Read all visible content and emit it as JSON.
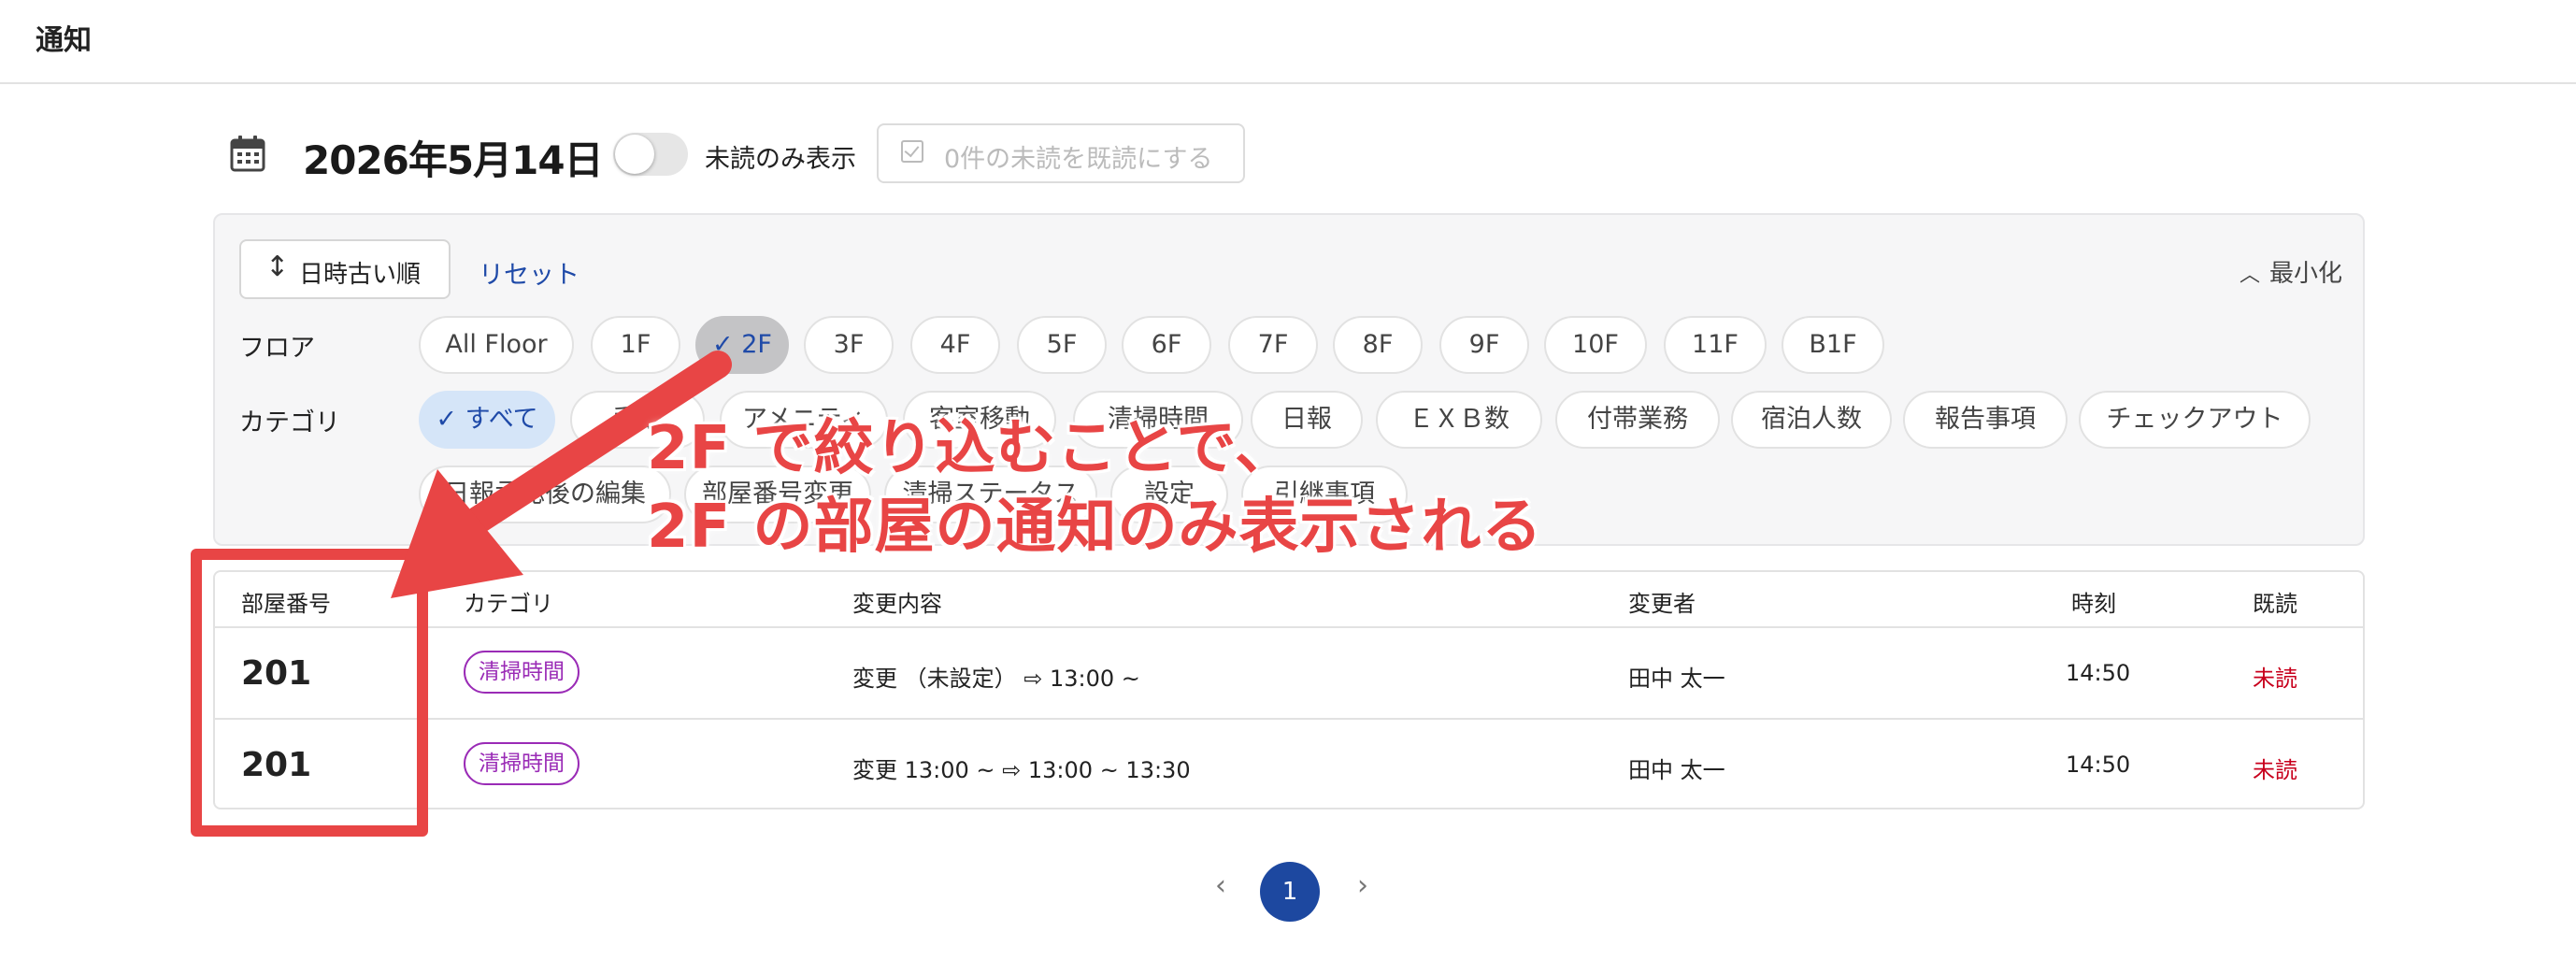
{
  "header": {
    "title": "通知"
  },
  "toolbar": {
    "date": "2026年5月14日",
    "unread_toggle_label": "未読のみ表示",
    "mark_read_label": "0件の未読を既読にする"
  },
  "filters": {
    "sort_label": "日時古い順",
    "reset_label": "リセット",
    "minimize_label": "最小化",
    "floor_label": "フロア",
    "floors": [
      "All Floor",
      "1F",
      "2F",
      "3F",
      "4F",
      "5F",
      "6F",
      "7F",
      "8F",
      "9F",
      "10F",
      "11F",
      "B1F"
    ],
    "selected_floor": "2F",
    "category_label": "カテゴリ",
    "categories_row1": [
      "すべて",
      "手配",
      "アメニティ",
      "客室移動",
      "清掃時間",
      "日報",
      "ＥＸＢ数",
      "付帯業務",
      "宿泊人数",
      "報告事項",
      "チェックアウト"
    ],
    "categories_row2": [
      "日報承認後の編集",
      "部屋番号変更",
      "清掃ステータス",
      "設定",
      "引継事項"
    ],
    "selected_category": "すべて"
  },
  "table": {
    "columns": [
      "部屋番号",
      "カテゴリ",
      "変更内容",
      "変更者",
      "時刻",
      "既読"
    ],
    "rows": [
      {
        "room": "201",
        "category": "清掃時間",
        "change": "変更 （未設定） ⇨ 13:00 ~",
        "user": "田中 太一",
        "time": "14:50",
        "status": "未読"
      },
      {
        "room": "201",
        "category": "清掃時間",
        "change": "変更 13:00 ~ ⇨ 13:00 ~ 13:30",
        "user": "田中 太一",
        "time": "14:50",
        "status": "未読"
      }
    ]
  },
  "pagination": {
    "prev": "‹",
    "current": "1",
    "next": "›"
  },
  "annotation": {
    "line1": "2F で絞り込むことで、",
    "line2": "2F の部屋の通知のみ表示される",
    "color": "#e84545"
  }
}
